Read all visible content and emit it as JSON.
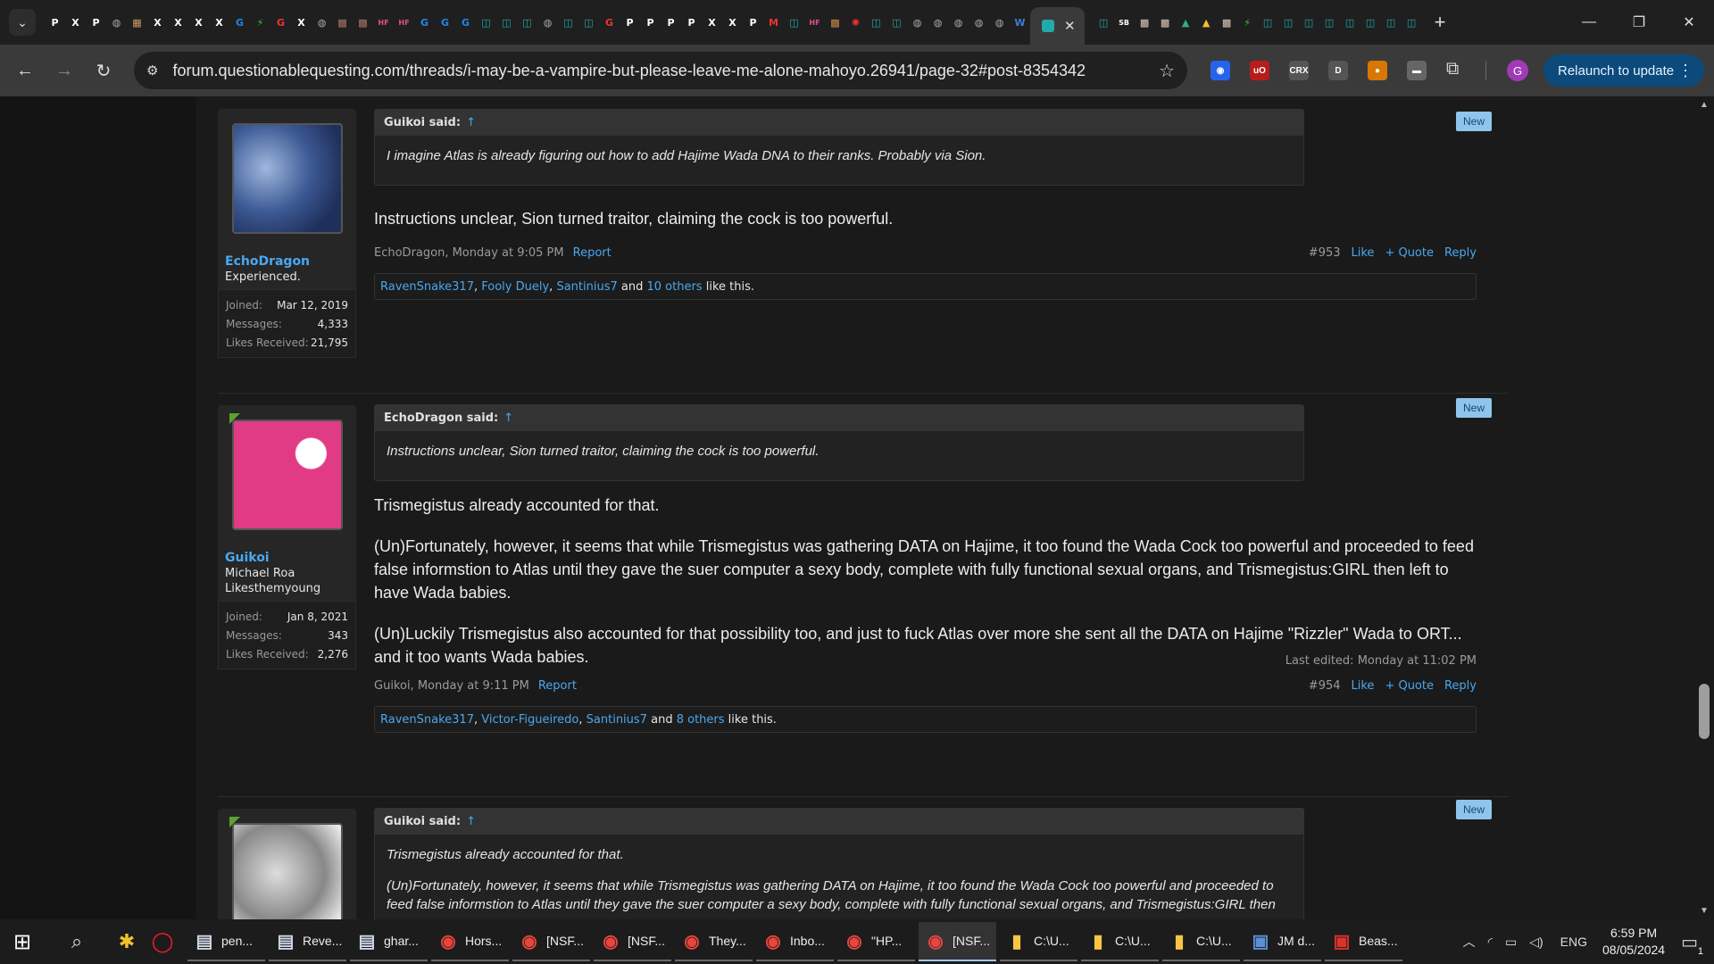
{
  "browser": {
    "active_tab_close": "✕",
    "new_tab": "+",
    "url": "forum.questionablequesting.com/threads/i-may-be-a-vampire-but-please-leave-me-alone-mahoyo.26941/page-32#post-8354342",
    "relaunch_label": "Relaunch to update",
    "profile_initial": "G",
    "tab_icon_glyphs": [
      "P",
      "X",
      "P",
      "◍",
      "▦",
      "X",
      "X",
      "X",
      "X",
      "G",
      "⚡",
      "G",
      "X",
      "◍",
      "▩",
      "▩",
      "HF",
      "HF",
      "G",
      "G",
      "G",
      "◫",
      "◫",
      "◫",
      "◍",
      "◫",
      "◫",
      "G",
      "P",
      "P",
      "P",
      "P",
      "X",
      "X",
      "P",
      "M",
      "◫",
      "HF",
      "▩",
      "✺",
      "◫",
      "◫",
      "◍",
      "◍",
      "◍",
      "◍",
      "◍",
      "W"
    ],
    "tab_icon_colors": [
      "#fff",
      "#fff",
      "#fff",
      "#aaa",
      "#c96",
      "#fff",
      "#fff",
      "#fff",
      "#fff",
      "#1e88e5",
      "#3c3",
      "#e33",
      "#fff",
      "#aaa",
      "#a76",
      "#a76",
      "#e05090",
      "#e05090",
      "#1e88e5",
      "#1e88e5",
      "#1e88e5",
      "#2aa",
      "#2aa",
      "#2aa",
      "#aaa",
      "#2aa",
      "#2aa",
      "#e33",
      "#fff",
      "#fff",
      "#fff",
      "#fff",
      "#fff",
      "#fff",
      "#fff",
      "#e33",
      "#2aa",
      "#e05090",
      "#c84",
      "#e33",
      "#2aa",
      "#2aa",
      "#aaa",
      "#aaa",
      "#aaa",
      "#aaa",
      "#aaa",
      "#3b7dd8"
    ],
    "tab_icons_after": [
      "◫",
      "SB",
      "▩",
      "▩",
      "▲",
      "▲",
      "▩",
      "⚡",
      "◫",
      "◫",
      "◫",
      "◫",
      "◫",
      "◫",
      "◫",
      "◫"
    ],
    "tab_icons_after_colors": [
      "#2aa",
      "#fff",
      "#dcb",
      "#dcb",
      "#3a8",
      "#fb3",
      "#dcb",
      "#3c3",
      "#2aa",
      "#2aa",
      "#2aa",
      "#2aa",
      "#2aa",
      "#2aa",
      "#2aa",
      "#2aa"
    ],
    "extensions": [
      {
        "glyph": "◉",
        "color": "#2563eb"
      },
      {
        "glyph": "uO",
        "color": "#b91c1c"
      },
      {
        "glyph": "CRX",
        "color": "#555"
      },
      {
        "glyph": "D",
        "color": "#555"
      },
      {
        "glyph": "●",
        "color": "#d97706"
      },
      {
        "glyph": "▬",
        "color": "#666"
      }
    ]
  },
  "posts": [
    {
      "new_badge": "New",
      "user": {
        "name": "EchoDragon",
        "title": "Experienced.",
        "title2": "",
        "joined_label": "Joined:",
        "joined": "Mar 12, 2019",
        "messages_label": "Messages:",
        "messages": "4,333",
        "likes_label": "Likes Received:",
        "likes": "21,795"
      },
      "quote_author": "Guikoi said:",
      "quote_arrow": "↑",
      "quote_paragraphs": [
        "I imagine Atlas is already figuring out how to add Hajime Wada DNA to their ranks. Probably via Sion."
      ],
      "body": [
        "Instructions unclear, Sion turned traitor, claiming the cock is too powerful."
      ],
      "edited": "",
      "meta_author": "EchoDragon, Monday at 9:05 PM",
      "report": "Report",
      "number": "#953",
      "like": "Like",
      "quote": "+ Quote",
      "reply": "Reply",
      "likers": [
        "RavenSnake317",
        "Fooly Duely",
        "Santinius7"
      ],
      "and": "and",
      "others": "10 others",
      "like_suffix": "like this."
    },
    {
      "new_badge": "New",
      "user": {
        "name": "Guikoi",
        "title": "Michael Roa",
        "title2": "Likesthemyoung",
        "joined_label": "Joined:",
        "joined": "Jan 8, 2021",
        "messages_label": "Messages:",
        "messages": "343",
        "likes_label": "Likes Received:",
        "likes": "2,276"
      },
      "quote_author": "EchoDragon said:",
      "quote_arrow": "↑",
      "quote_paragraphs": [
        "Instructions unclear, Sion turned traitor, claiming the cock is too powerful."
      ],
      "body": [
        "Trismegistus already accounted for that.",
        "(Un)Fortunately, however, it seems that while Trismegistus was gathering DATA on Hajime, it too found the Wada Cock too powerful and proceeded to feed false informstion to Atlas until they gave the suer computer a sexy body, complete with fully functional sexual organs, and Trismegistus:GIRL then left to have Wada babies.",
        "(Un)Luckily Trismegistus also accounted for that possibility too, and just to fuck Atlas over more she sent all the DATA on Hajime \"Rizzler\" Wada to ORT... and it too wants Wada babies."
      ],
      "edited": "Last edited: Monday at 11:02 PM",
      "meta_author": "Guikoi, Monday at 9:11 PM",
      "report": "Report",
      "number": "#954",
      "like": "Like",
      "quote": "+ Quote",
      "reply": "Reply",
      "likers": [
        "RavenSnake317",
        "Victor-Figueiredo",
        "Santinius7"
      ],
      "and": "and",
      "others": "8 others",
      "like_suffix": "like this."
    },
    {
      "new_badge": "New",
      "quote_author": "Guikoi said:",
      "quote_arrow": "↑",
      "quote_paragraphs": [
        "Trismegistus already accounted for that.",
        "(Un)Fortunately, however, it seems that while Trismegistus was gathering DATA on Hajime, it too found the Wada Cock too powerful and proceeded to feed false informstion to Atlas until they gave the suer computer a sexy body, complete with fully functional sexual organs, and Trismegistus:GIRL then"
      ]
    }
  ],
  "taskbar": {
    "apps": [
      {
        "label": "pen...",
        "icon": "▤",
        "color": "#cfd8e6"
      },
      {
        "label": "Reve...",
        "icon": "▤",
        "color": "#cfd8e6"
      },
      {
        "label": "ghar...",
        "icon": "▤",
        "color": "#cfd8e6"
      },
      {
        "label": "Hors...",
        "icon": "◉",
        "color": "#e8453c"
      },
      {
        "label": "[NSF...",
        "icon": "◉",
        "color": "#e8453c"
      },
      {
        "label": "[NSF...",
        "icon": "◉",
        "color": "#e8453c"
      },
      {
        "label": "They...",
        "icon": "◉",
        "color": "#e8453c"
      },
      {
        "label": "Inbo...",
        "icon": "◉",
        "color": "#e8453c"
      },
      {
        "label": "\"HP...",
        "icon": "◉",
        "color": "#e8453c"
      },
      {
        "label": "[NSF...",
        "icon": "◉",
        "color": "#e8453c"
      },
      {
        "label": "C:\\U...",
        "icon": "▮",
        "color": "#f6c744"
      },
      {
        "label": "C:\\U...",
        "icon": "▮",
        "color": "#f6c744"
      },
      {
        "label": "C:\\U...",
        "icon": "▮",
        "color": "#f6c744"
      },
      {
        "label": "JM d...",
        "icon": "▣",
        "color": "#5b8fd6"
      },
      {
        "label": "Beas...",
        "icon": "▣",
        "color": "#d9342b"
      }
    ],
    "lang": "ENG",
    "time": "6:59 PM",
    "date": "08/05/2024",
    "notifications": "1"
  }
}
